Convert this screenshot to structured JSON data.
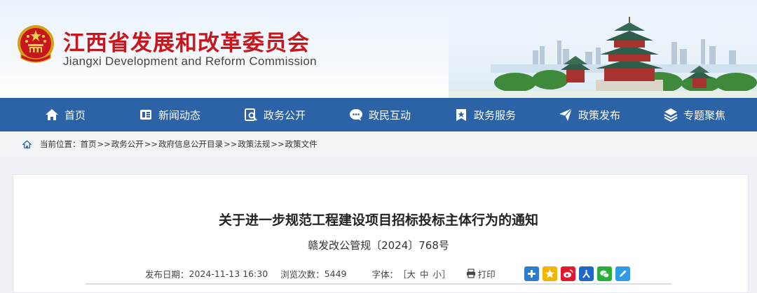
{
  "header": {
    "title": "江西省发展和改革委员会",
    "subtitle": "Jiangxi Development and Reform Commission"
  },
  "nav": {
    "items": [
      {
        "label": "首页",
        "icon": "home-icon"
      },
      {
        "label": "新闻动态",
        "icon": "newspaper-icon"
      },
      {
        "label": "政务公开",
        "icon": "search-document-icon"
      },
      {
        "label": "政民互动",
        "icon": "chat-bubble-icon"
      },
      {
        "label": "政务服务",
        "icon": "bookmark-star-icon"
      },
      {
        "label": "政策发布",
        "icon": "paper-plane-icon"
      },
      {
        "label": "专题聚焦",
        "icon": "layers-icon"
      }
    ]
  },
  "breadcrumb": {
    "prefix": "当前位置：",
    "items": [
      "首页",
      "政务公开",
      "政府信息公开目录",
      "政策法规",
      "政策文件"
    ],
    "separator": ">>"
  },
  "article": {
    "title": "关于进一步规范工程建设项目招标投标主体行为的通知",
    "doc_number": "赣发改公管规〔2024〕768号",
    "meta": {
      "date_label": "发布日期：",
      "date_value": "2024-11-13 16:30",
      "views_label": "浏览次数：",
      "views_value": "5449",
      "font_label": "字体：",
      "font_open": "［",
      "font_large": "大",
      "font_medium": "中",
      "font_small": "小",
      "font_close": "］",
      "print_label": "打印"
    },
    "share_icons": [
      "plus-share-icon",
      "qzone-star-icon",
      "weibo-icon",
      "renren-icon",
      "wechat-icon",
      "pencil-icon"
    ]
  },
  "colors": {
    "brand_red": "#c8161d",
    "nav_blue": "#2c63a6"
  }
}
